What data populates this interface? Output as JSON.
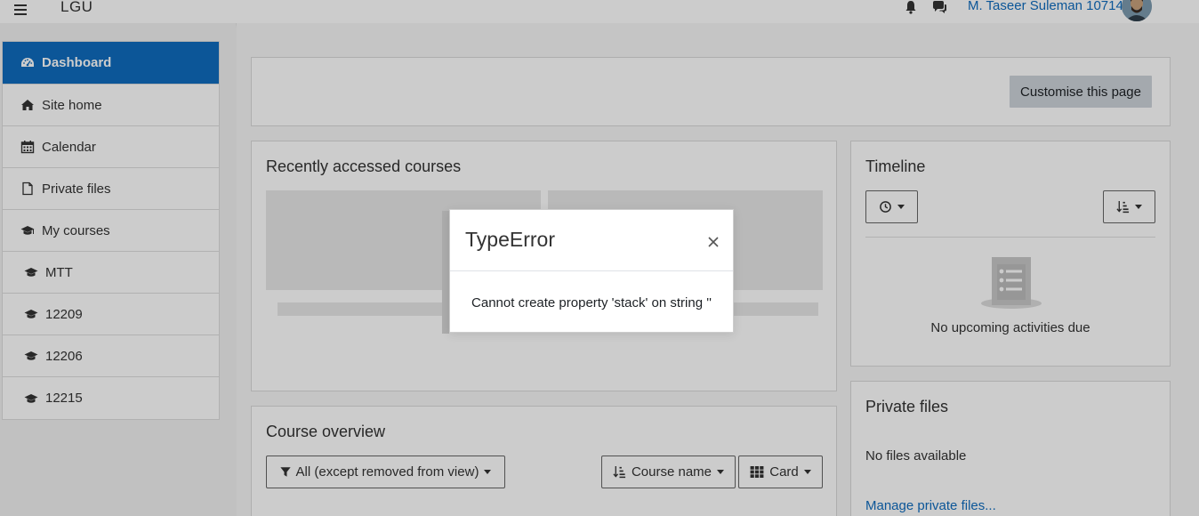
{
  "navbar": {
    "brand": "LGU",
    "username": "M. Taseer Suleman 10714"
  },
  "sidebar": {
    "items": [
      {
        "label": "Dashboard",
        "icon": "dashboard-icon",
        "active": true
      },
      {
        "label": "Site home",
        "icon": "home-icon"
      },
      {
        "label": "Calendar",
        "icon": "calendar-icon"
      },
      {
        "label": "Private files",
        "icon": "file-icon"
      },
      {
        "label": "My courses",
        "icon": "graduation-cap-icon"
      },
      {
        "label": "MTT",
        "icon": "graduation-cap-icon"
      },
      {
        "label": "12209",
        "icon": "graduation-cap-icon"
      },
      {
        "label": "12206",
        "icon": "graduation-cap-icon"
      },
      {
        "label": "12215",
        "icon": "graduation-cap-icon"
      }
    ]
  },
  "header_card": {
    "customise_label": "Customise this page"
  },
  "recent_courses": {
    "title": "Recently accessed courses"
  },
  "timeline": {
    "title": "Timeline",
    "empty_text": "No upcoming activities due"
  },
  "course_overview": {
    "title": "Course overview",
    "filter_label": "All (except removed from view)",
    "sort_label": "Course name",
    "view_label": "Card"
  },
  "private_files": {
    "title": "Private files",
    "empty_text": "No files available",
    "manage_link": "Manage private files..."
  },
  "modal": {
    "title": "TypeError",
    "message": "Cannot create property 'stack' on string ''"
  },
  "colors": {
    "primary": "#0f6cbf",
    "secondary_button": "#ced4da"
  }
}
